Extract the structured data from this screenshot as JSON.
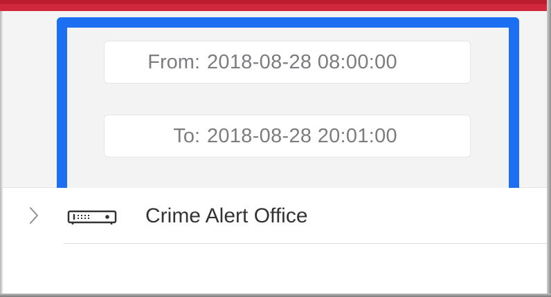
{
  "header": {
    "accent_color": "#d0283a"
  },
  "time_filter": {
    "highlight_color": "#1d6ff2",
    "from_label": "From:",
    "from_value": "2018-08-28 08:00:00",
    "to_label": "To:",
    "to_value": "2018-08-28 20:01:00"
  },
  "device_list": {
    "items": [
      {
        "name": "Crime Alert Office",
        "icon": "nvr-recorder-icon",
        "expand_icon": "chevron-right-icon"
      }
    ]
  }
}
